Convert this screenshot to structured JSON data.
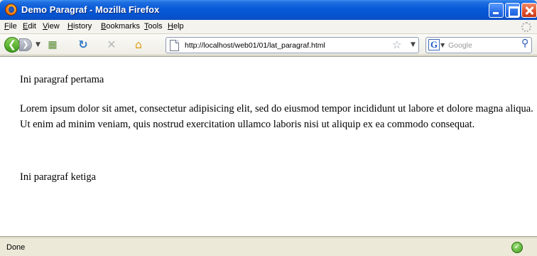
{
  "window": {
    "title": "Demo Paragraf - Mozilla Firefox"
  },
  "menubar": {
    "items": [
      "File",
      "Edit",
      "View",
      "History",
      "Bookmarks",
      "Tools",
      "Help"
    ]
  },
  "navbar": {
    "back_icon": "back-arrow-icon",
    "forward_icon": "forward-arrow-icon",
    "url": "http://localhost/web01/01/lat_paragraf.html",
    "search_placeholder": "Google"
  },
  "content": {
    "paragraphs": [
      "Ini paragraf pertama",
      "Lorem ipsum dolor sit amet, consectetur adipisicing elit, sed do eiusmod tempor incididunt ut labore et dolore magna aliqua. Ut enim ad minim veniam, quis nostrud exercitation ullamco laboris nisi ut aliquip ex ea commodo consequat.",
      "Ini paragraf ketiga"
    ]
  },
  "statusbar": {
    "text": "Done"
  },
  "colors": {
    "titlebar": "#0a5bd8",
    "close_button": "#e0512c",
    "back_button": "#3f9d1a"
  }
}
